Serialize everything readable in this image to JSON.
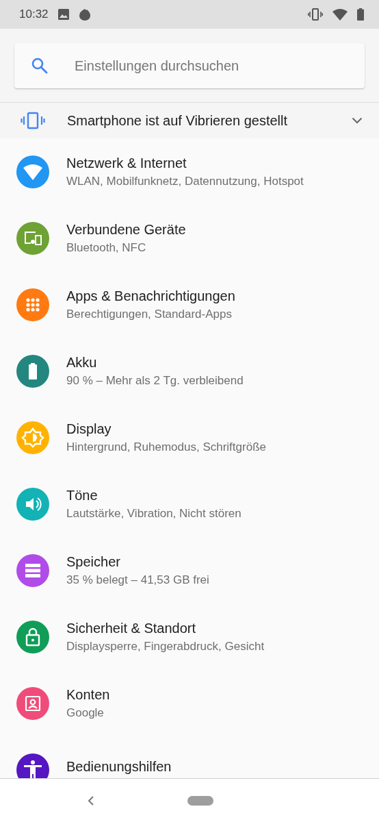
{
  "status_bar": {
    "time": "10:32"
  },
  "search": {
    "placeholder": "Einstellungen durchsuchen"
  },
  "suggestion": {
    "text": "Smartphone ist auf Vibrieren gestellt",
    "expanded": false
  },
  "items": [
    {
      "kind": "wifi",
      "title": "Netzwerk & Internet",
      "subtitle": "WLAN, Mobilfunknetz, Datennutzung, Hotspot",
      "color": "#2196f3"
    },
    {
      "kind": "devices",
      "title": "Verbundene Geräte",
      "subtitle": "Bluetooth, NFC",
      "color": "#6ea235"
    },
    {
      "kind": "apps",
      "title": "Apps & Benachrichtigungen",
      "subtitle": "Berechtigungen, Standard-Apps",
      "color": "#ff7a10"
    },
    {
      "kind": "battery",
      "title": "Akku",
      "subtitle": "90 % – Mehr als 2 Tg. verbleibend",
      "color": "#23877f"
    },
    {
      "kind": "display",
      "title": "Display",
      "subtitle": "Hintergrund, Ruhemodus, Schriftgröße",
      "color": "#ffb300"
    },
    {
      "kind": "sound",
      "title": "Töne",
      "subtitle": "Lautstärke, Vibration, Nicht stören",
      "color": "#12b2b5"
    },
    {
      "kind": "storage",
      "title": "Speicher",
      "subtitle": "35 % belegt – 41,53 GB frei",
      "color": "#b04ce8"
    },
    {
      "kind": "lock",
      "title": "Sicherheit & Standort",
      "subtitle": "Displaysperre, Fingerabdruck, Gesicht",
      "color": "#0f9d58"
    },
    {
      "kind": "account",
      "title": "Konten",
      "subtitle": "Google",
      "color": "#ef4c7a"
    },
    {
      "kind": "accessibility",
      "title": "Bedienungshilfen",
      "color": "#5417c2"
    }
  ]
}
